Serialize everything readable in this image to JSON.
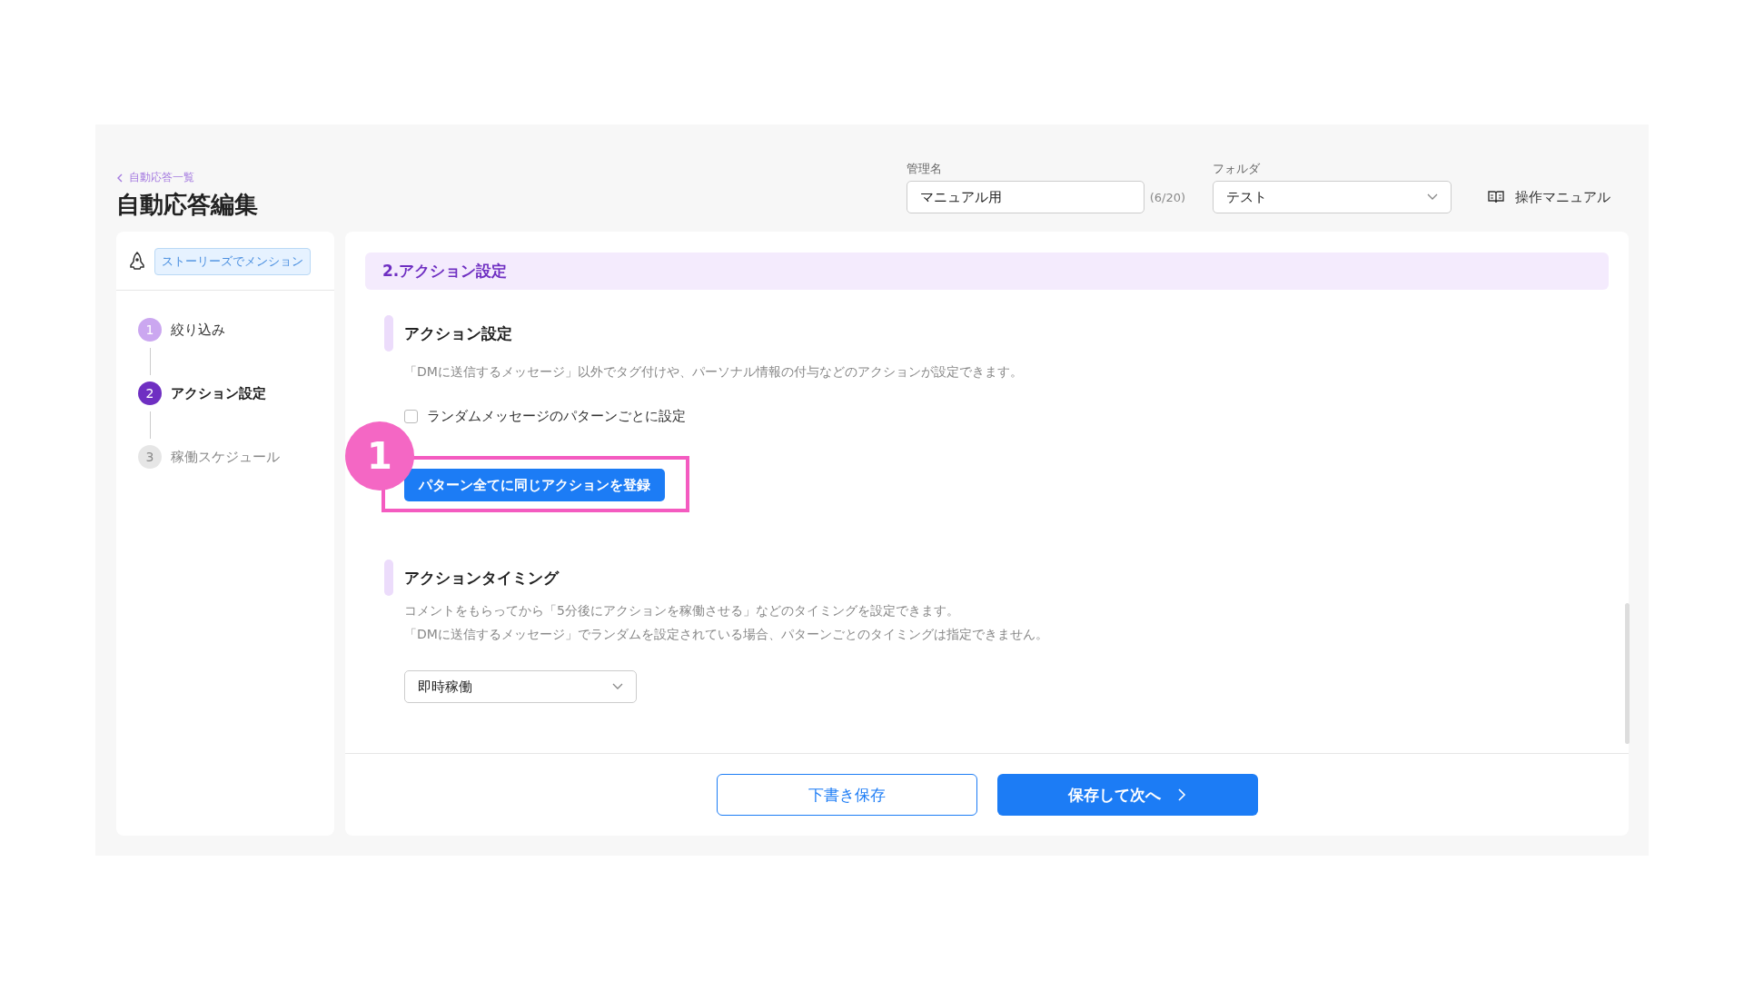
{
  "header": {
    "back_link": "自動応答一覧",
    "title": "自動応答編集",
    "name_field": {
      "label": "管理名",
      "value": "マニュアル用",
      "counter": "(6/20)"
    },
    "folder_field": {
      "label": "フォルダ",
      "value": "テスト"
    },
    "manual_link": "操作マニュアル"
  },
  "sidebar": {
    "trigger_tag": "ストーリーズでメンション",
    "steps": [
      {
        "number": "1",
        "label": "絞り込み",
        "kind": "done"
      },
      {
        "number": "2",
        "label": "アクション設定",
        "kind": "current"
      },
      {
        "number": "3",
        "label": "稼働スケジュール",
        "kind": "upcoming"
      }
    ]
  },
  "main": {
    "section_title": "2.アクション設定",
    "action_settings": {
      "heading": "アクション設定",
      "description": "「DMに送信するメッセージ」以外でタグ付けや、パーソナル情報の付与などのアクションが設定できます。",
      "checkbox": {
        "label": "ランダムメッセージのパターンごとに設定",
        "checked": false
      },
      "register_button": "パターン全てに同じアクションを登録",
      "annotation": "1"
    },
    "action_timing": {
      "heading": "アクションタイミング",
      "description_lines": [
        "コメントをもらってから「5分後にアクションを稼働させる」などのタイミングを設定できます。",
        "「DMに送信するメッセージ」でランダムを設定されている場合、パターンごとのタイミングは指定できません。"
      ],
      "select_value": "即時稼働"
    },
    "footer_buttons": [
      {
        "label": "下書き保存",
        "kind": "secondary"
      },
      {
        "label": "保存して次へ",
        "kind": "primary"
      }
    ]
  }
}
